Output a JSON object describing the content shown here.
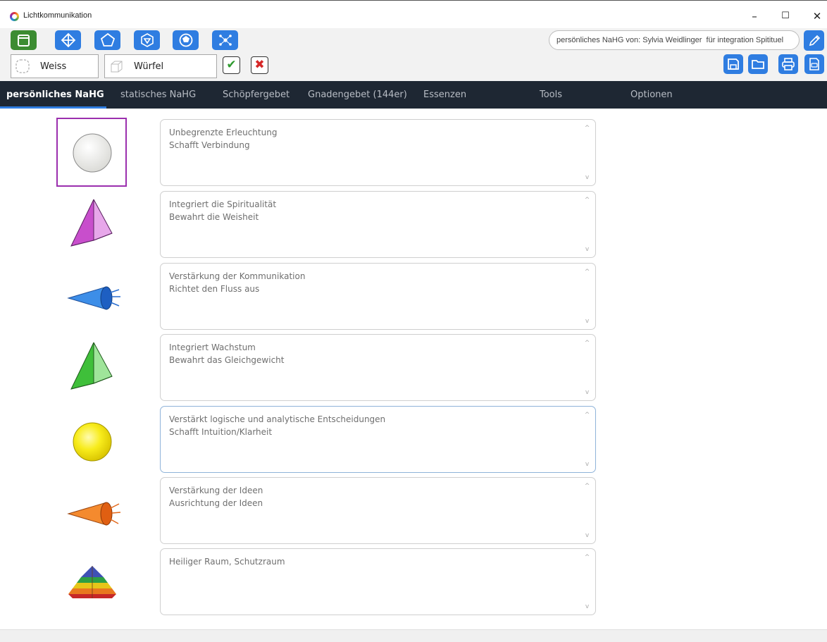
{
  "window": {
    "title": "Lichtkommunikation",
    "minimize_glyph": "–",
    "maximize_glyph": "☐",
    "close_glyph": "✕"
  },
  "toolbar": {
    "shape_buttons": [
      {
        "icon": "cube-icon",
        "active": true
      },
      {
        "icon": "octahedron-icon",
        "active": false
      },
      {
        "icon": "pentagon-icon",
        "active": false
      },
      {
        "icon": "icosahedron-icon",
        "active": false
      },
      {
        "icon": "dodecahedron-icon",
        "active": false
      },
      {
        "icon": "star-cluster-icon",
        "active": false
      }
    ],
    "color_select_value": "Weiss",
    "shape_select_value": "Würfel",
    "ok_glyph": "✔",
    "cancel_glyph": "✖",
    "title_input_value": "persönliches NaHG von: Sylvia Weidlinger  für integration Spitituel",
    "action_buttons": [
      "save-icon",
      "folder-open-icon",
      "print-icon",
      "pdf-export-icon"
    ]
  },
  "tabs": [
    {
      "label": "persönliches NaHG",
      "active": true
    },
    {
      "label": "statisches NaHG",
      "active": false
    },
    {
      "label": "Schöpfergebet",
      "active": false
    },
    {
      "label": "Gnadengebet (144er)",
      "active": false
    },
    {
      "label": "Essenzen",
      "active": false
    },
    {
      "label": "Tools",
      "active": false
    },
    {
      "label": "Optionen",
      "active": false
    }
  ],
  "rows": [
    {
      "shape": "white-sphere",
      "color": "#f4f4f2",
      "line1": "Unbegrenzte Erleuchtung",
      "line2": "Schafft Verbindung",
      "selected": true
    },
    {
      "shape": "magenta-pyramid",
      "color": "#d45ed8",
      "line1": "Integriert die Spiritualität",
      "line2": "Bewahrt die Weisheit"
    },
    {
      "shape": "blue-cone",
      "color": "#2a6fd6",
      "line1": "Verstärkung der Kommunikation",
      "line2": "Richtet den Fluss aus"
    },
    {
      "shape": "green-pyramid",
      "color": "#49c944",
      "line1": "Integriert Wachstum",
      "line2": "Bewahrt das Gleichgewicht"
    },
    {
      "shape": "yellow-sphere",
      "color": "#f6ea1a",
      "line1": "Verstärkt logische und analytische Entscheidungen",
      "line2": "Schafft Intuition/Klarheit",
      "focused": true
    },
    {
      "shape": "orange-cone",
      "color": "#f07a1e",
      "line1": "Verstärkung der Ideen",
      "line2": "Ausrichtung der Ideen"
    },
    {
      "shape": "rainbow-pyramid",
      "color": "#c0392b",
      "line1": "Heiliger Raum, Schutzraum",
      "line2": ""
    }
  ],
  "scroll": {
    "up_glyph": "^",
    "down_glyph": "v"
  }
}
